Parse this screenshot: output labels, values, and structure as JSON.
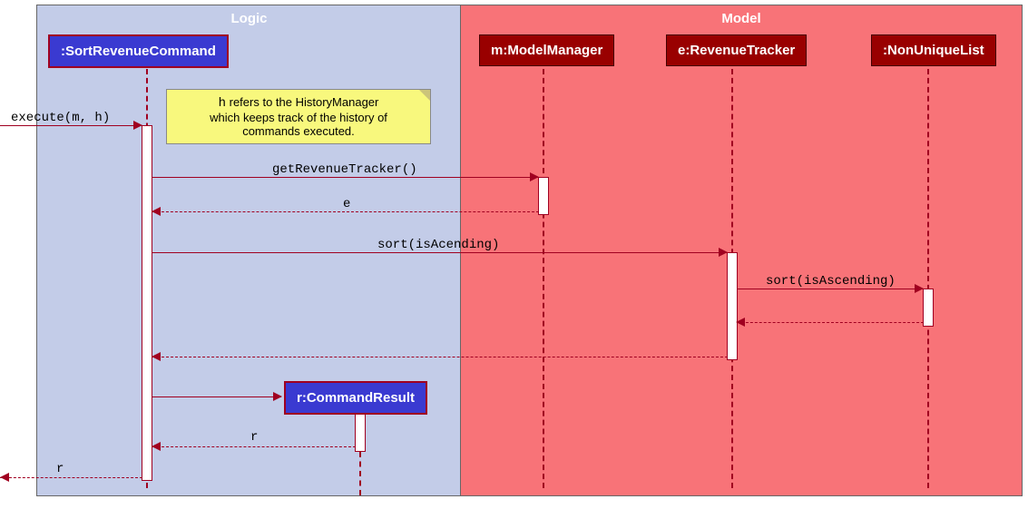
{
  "boxes": {
    "logic": "Logic",
    "model": "Model"
  },
  "participants": {
    "sort": ":SortRevenueCommand",
    "mm": "m:ModelManager",
    "rt": "e:RevenueTracker",
    "nul": ":NonUniqueList",
    "cr": "r:CommandResult"
  },
  "note": {
    "line1_pre": "h",
    "line1_post": " refers to the HistoryManager",
    "line2": "which keeps track of the history of",
    "line3": "commands executed."
  },
  "messages": {
    "execute": "execute(m, h)",
    "getRT": "getRevenueTracker()",
    "ret_e": "e",
    "sort1": "sort(isAcending)",
    "sort2": "sort(isAscending)",
    "ret_r": "r",
    "ret_r2": "r"
  },
  "chart_data": {
    "type": "sequence-diagram",
    "boxes": [
      {
        "name": "Logic",
        "participants": [
          ":SortRevenueCommand",
          "r:CommandResult"
        ]
      },
      {
        "name": "Model",
        "participants": [
          "m:ModelManager",
          "e:RevenueTracker",
          ":NonUniqueList"
        ]
      }
    ],
    "participants": [
      ":SortRevenueCommand",
      "m:ModelManager",
      "e:RevenueTracker",
      ":NonUniqueList",
      "r:CommandResult"
    ],
    "messages": [
      {
        "from": "caller",
        "to": ":SortRevenueCommand",
        "label": "execute(m, h)",
        "type": "call"
      },
      {
        "from": ":SortRevenueCommand",
        "to": "m:ModelManager",
        "label": "getRevenueTracker()",
        "type": "call"
      },
      {
        "from": "m:ModelManager",
        "to": ":SortRevenueCommand",
        "label": "e",
        "type": "return"
      },
      {
        "from": ":SortRevenueCommand",
        "to": "e:RevenueTracker",
        "label": "sort(isAcending)",
        "type": "call"
      },
      {
        "from": "e:RevenueTracker",
        "to": ":NonUniqueList",
        "label": "sort(isAscending)",
        "type": "call"
      },
      {
        "from": ":NonUniqueList",
        "to": "e:RevenueTracker",
        "label": "",
        "type": "return"
      },
      {
        "from": "e:RevenueTracker",
        "to": ":SortRevenueCommand",
        "label": "",
        "type": "return"
      },
      {
        "from": ":SortRevenueCommand",
        "to": "r:CommandResult",
        "label": "",
        "type": "create"
      },
      {
        "from": "r:CommandResult",
        "to": ":SortRevenueCommand",
        "label": "r",
        "type": "return"
      },
      {
        "from": ":SortRevenueCommand",
        "to": "caller",
        "label": "r",
        "type": "return"
      }
    ],
    "note": "h refers to the HistoryManager which keeps track of the history of commands executed."
  }
}
